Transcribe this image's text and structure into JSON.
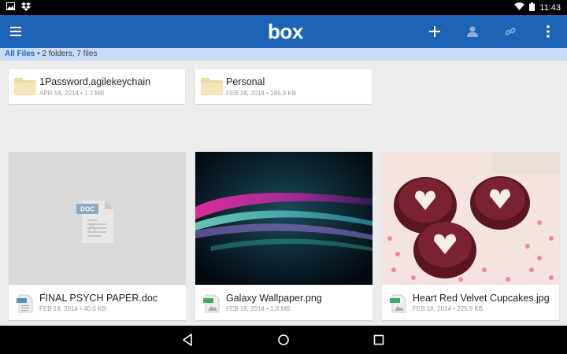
{
  "status_bar": {
    "time": "11:43",
    "left_icons": [
      "image-icon",
      "dropbox-icon"
    ],
    "right_icons": [
      "wifi-icon",
      "battery-icon"
    ]
  },
  "app_bar": {
    "brand": "box",
    "actions": [
      "add-icon",
      "person-icon",
      "link-icon",
      "overflow-icon"
    ],
    "color": "#1f63b7"
  },
  "breadcrumb": {
    "root": "All Files",
    "summary": " • 2 folders, 7 files"
  },
  "folders": [
    {
      "name": "1Password.agilekeychain",
      "meta": "APR 18, 2014 • 1.1 MB"
    },
    {
      "name": "Personal",
      "meta": "FEB 18, 2014 • 186.9 KB"
    }
  ],
  "files": [
    {
      "name": "FINAL PSYCH PAPER.doc",
      "meta": "FEB 18, 2014 • 40.0 KB",
      "type": "DOC"
    },
    {
      "name": "Galaxy Wallpaper.png",
      "meta": "FEB 18, 2014 • 1.8 MB",
      "type": "PNG"
    },
    {
      "name": "Heart Red Velvet Cupcakes.jpg",
      "meta": "FEB 18, 2014 • 225.9 KB",
      "type": "JPG"
    }
  ],
  "nav_bar": [
    "back-icon",
    "home-icon",
    "recents-icon"
  ]
}
